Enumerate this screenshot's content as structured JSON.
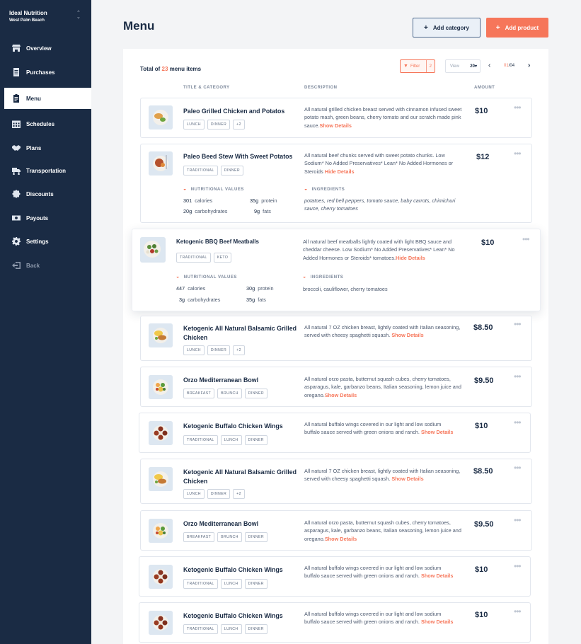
{
  "sidebar": {
    "brand_name": "Ideal Nutrition",
    "brand_location": "West Palm Beach",
    "items": [
      {
        "label": "Overview",
        "icon": "store-icon"
      },
      {
        "label": "Purchases",
        "icon": "receipt-icon"
      },
      {
        "label": "Menu",
        "icon": "clipboard-icon"
      },
      {
        "label": "Schedules",
        "icon": "calendar-icon"
      },
      {
        "label": "Plans",
        "icon": "handshake-icon"
      },
      {
        "label": "Transportation",
        "icon": "truck-icon"
      },
      {
        "label": "Discounts",
        "icon": "discount-icon"
      },
      {
        "label": "Payouts",
        "icon": "money-icon"
      },
      {
        "label": "Settings",
        "icon": "gear-icon"
      },
      {
        "label": "Back",
        "icon": "logout-icon"
      }
    ]
  },
  "header": {
    "title": "Menu",
    "add_category": "Add category",
    "add_product": "Add product"
  },
  "toolbar": {
    "total_prefix": "Total of ",
    "total_count": "23",
    "total_suffix": " menu items",
    "filter_label": "Filter",
    "filter_count": "2",
    "view_label": "View",
    "view_value": "20",
    "page_current": "01",
    "page_total": "/04"
  },
  "columns": {
    "title": "TITLE & CATEGORY",
    "description": "DESCRIPTION",
    "amount": "AMOUNT"
  },
  "labels": {
    "nutritional_values": "NUTRITIONAL VALUES",
    "ingredients": "INGREDIENTS",
    "show_details": "Show Details",
    "hide_details": "Hide Details",
    "more": "•••"
  },
  "items": [
    {
      "title": "Paleo Grilled Chicken and Potatos",
      "tags": [
        "LUNCH",
        "DINNER",
        "+2"
      ],
      "description": "All natural grilled chicken breast served with cinnamon infused sweet potato mash, green beans, cherry tomato and our scratch made pink sauce.",
      "link": "Show Details",
      "price": "$10"
    },
    {
      "title": "Paleo Beed Stew With Sweet Potatos",
      "tags": [
        "TRADITIONAL",
        "DINNER"
      ],
      "description": "All natural beef chunks served with sweet potato chunks. Low Sodium* No Added Preservatives* Lean* No Added Hormones or Steroids",
      "link": "Hide Details",
      "price": "$12",
      "nutrition": {
        "calories": "301",
        "calories_unit": "calories",
        "carbs": "20g",
        "carbs_unit": "carbohydrates",
        "protein": "35g",
        "protein_unit": "protein",
        "fats": "9g",
        "fats_unit": "fats"
      },
      "ingredients": "potatoes, red bell peppers, tomato sauce, baby carrots, chimichuri sauce, cherry tomatoes"
    },
    {
      "title": "Ketogenic BBQ Beef Meatballs",
      "tags": [
        "TRADITIONAL",
        "KETO"
      ],
      "description": "All natural beef meatballs lightly coated with light BBQ sauce and cheddar cheese. Low Sodium* No Added Preservatives* Lean* No Added Hormones or Steroids* tomatoes.",
      "link": "Hide Details",
      "price": "$10",
      "nutrition": {
        "calories": "447",
        "calories_unit": "calories",
        "carbs": "3g",
        "carbs_unit": "carbohydrates",
        "protein": "30g",
        "protein_unit": "protein",
        "fats": "35g",
        "fats_unit": "fats"
      },
      "ingredients": "broccoli, cauliflower, cherry tomatoes"
    },
    {
      "title": "Ketogenic All Natural Balsamic Grilled Chicken",
      "tags": [
        "LUNCH",
        "DINNER",
        "+2"
      ],
      "description": "All natural 7 OZ chicken breast, lightly coated with Italian seasoning, served with cheesy spaghetti squash.",
      "link": "Show Details",
      "price": "$8.50"
    },
    {
      "title": "Orzo Mediterranean Bowl",
      "tags": [
        "BREAKFAST",
        "BRUNCH",
        "DINNER"
      ],
      "description": "All natural orzo pasta, butternut squash cubes, cherry tomatoes, asparagus, kale, garbanzo beans, Italian seasoning, lemon juice and oregano.",
      "link": "Show Details",
      "price": "$9.50"
    },
    {
      "title": "Ketogenic Buffalo Chicken Wings",
      "tags": [
        "TRADITIONAL",
        "LUNCH",
        "DINNER"
      ],
      "description": "All natural buffalo wings covered in our light and low sodium buffalo sauce served with green onions and ranch.",
      "link": "Show Details",
      "price": "$10"
    },
    {
      "title": "Ketogenic All Natural Balsamic Grilled Chicken",
      "tags": [
        "LUNCH",
        "DINNER",
        "+2"
      ],
      "description": "All natural 7 OZ chicken breast, lightly coated with Italian seasoning, served with cheesy spaghetti squash.",
      "link": "Show Details",
      "price": "$8.50"
    },
    {
      "title": "Orzo Mediterranean Bowl",
      "tags": [
        "BREAKFAST",
        "BRUNCH",
        "DINNER"
      ],
      "description": "All natural orzo pasta, butternut squash cubes, cherry tomatoes, asparagus, kale, garbanzo beans, Italian seasoning, lemon juice and oregano.",
      "link": "Show Details",
      "price": "$9.50"
    },
    {
      "title": "Ketogenic Buffalo Chicken Wings",
      "tags": [
        "TRADITIONAL",
        "LUNCH",
        "DINNER"
      ],
      "description": "All natural buffalo wings covered in our light and low sodium buffalo sauce served with green onions and ranch.",
      "link": "Show Details",
      "price": "$10"
    },
    {
      "title": "Ketogenic Buffalo Chicken Wings",
      "tags": [
        "TRADITIONAL",
        "LUNCH",
        "DINNER"
      ],
      "description": "All natural buffalo wings covered in our light and low sodium buffalo sauce served with green onions and ranch.",
      "link": "Show Details",
      "price": "$10"
    }
  ],
  "colors": {
    "sidebar_bg": "#1a2b44",
    "accent": "#f6765a",
    "text_dark": "#1a2b44"
  }
}
